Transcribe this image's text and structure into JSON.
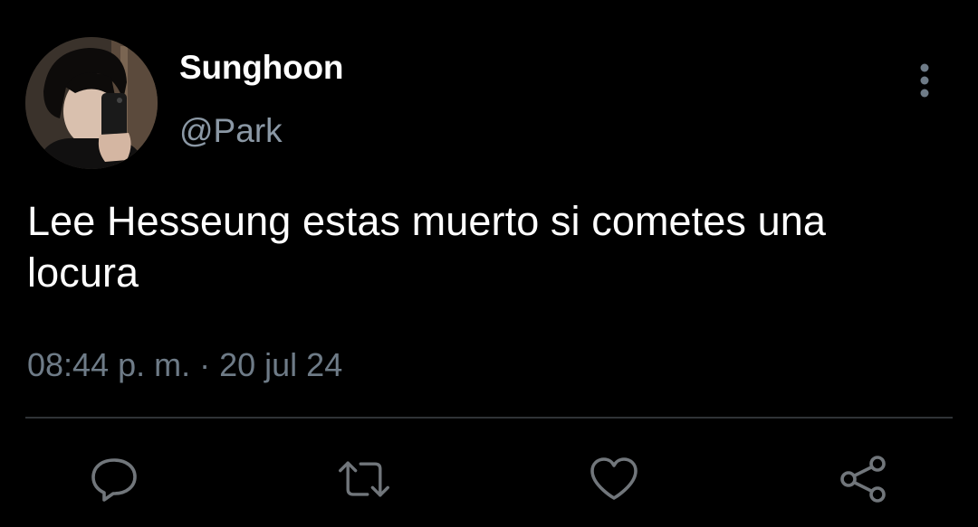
{
  "tweet": {
    "display_name": "Sunghoon",
    "handle": "@Park",
    "text": "Lee Hesseung estas muerto si cometes una locura",
    "time": "08:44 p. m.",
    "separator": "·",
    "date": "20 jul 24"
  },
  "actions": [
    {
      "name": "reply",
      "icon": "reply-icon"
    },
    {
      "name": "retweet",
      "icon": "retweet-icon"
    },
    {
      "name": "like",
      "icon": "heart-icon"
    },
    {
      "name": "share",
      "icon": "share-icon"
    }
  ],
  "colors": {
    "background": "#000000",
    "text_primary": "#ffffff",
    "text_secondary": "#8b98a5",
    "icon": "#71767b",
    "divider": "#2f3336"
  }
}
